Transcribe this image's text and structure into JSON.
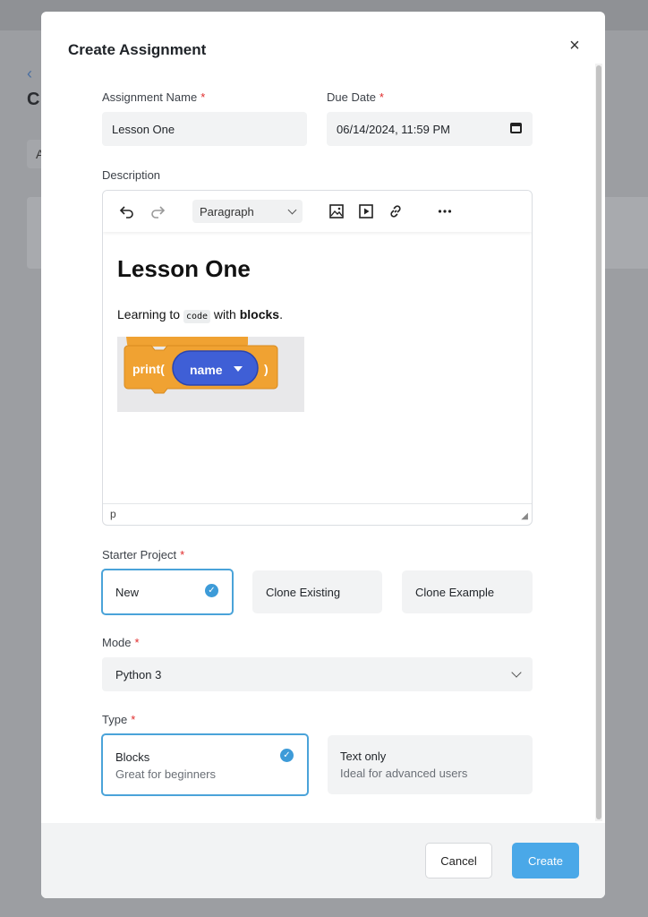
{
  "background": {
    "back_glyph": "‹",
    "title_initial": "C",
    "chip_initial": "A"
  },
  "modal": {
    "title": "Create Assignment",
    "close_glyph": "×"
  },
  "form": {
    "assignment_name": {
      "label": "Assignment Name",
      "value": "Lesson One",
      "required_mark": "*"
    },
    "due_date": {
      "label": "Due Date",
      "value": "06/14/2024, 11:59 PM",
      "required_mark": "*"
    },
    "description": {
      "label": "Description"
    },
    "starter_project": {
      "label": "Starter Project",
      "required_mark": "*",
      "options": [
        {
          "label": "New",
          "selected": true
        },
        {
          "label": "Clone Existing",
          "selected": false
        },
        {
          "label": "Clone Example",
          "selected": false
        }
      ]
    },
    "mode": {
      "label": "Mode",
      "required_mark": "*",
      "value": "Python 3"
    },
    "type": {
      "label": "Type",
      "required_mark": "*",
      "options": [
        {
          "label": "Blocks",
          "sub": "Great for beginners",
          "selected": true
        },
        {
          "label": "Text only",
          "sub": "Ideal for advanced users",
          "selected": false
        }
      ]
    }
  },
  "editor": {
    "toolbar": {
      "undo_icon": "undo-icon",
      "redo_icon": "redo-icon",
      "format_value": "Paragraph",
      "image_icon": "image-icon",
      "media_icon": "media-icon",
      "link_icon": "link-icon",
      "more_icon": "more-icon"
    },
    "content": {
      "heading": "Lesson One",
      "text_before": "Learning to ",
      "code": "code",
      "text_middle": " with ",
      "bold": "blocks",
      "text_after": ".",
      "block": {
        "keyword": "print(",
        "var": "name",
        "close": ")"
      }
    },
    "status_path": "p"
  },
  "footer": {
    "cancel_label": "Cancel",
    "create_label": "Create"
  },
  "colors": {
    "accent": "#4aa3d9",
    "primary_button": "#4aa8e8",
    "required": "#e02b2b",
    "block_orange": "#f0a232",
    "block_blue": "#3f5fd6"
  }
}
